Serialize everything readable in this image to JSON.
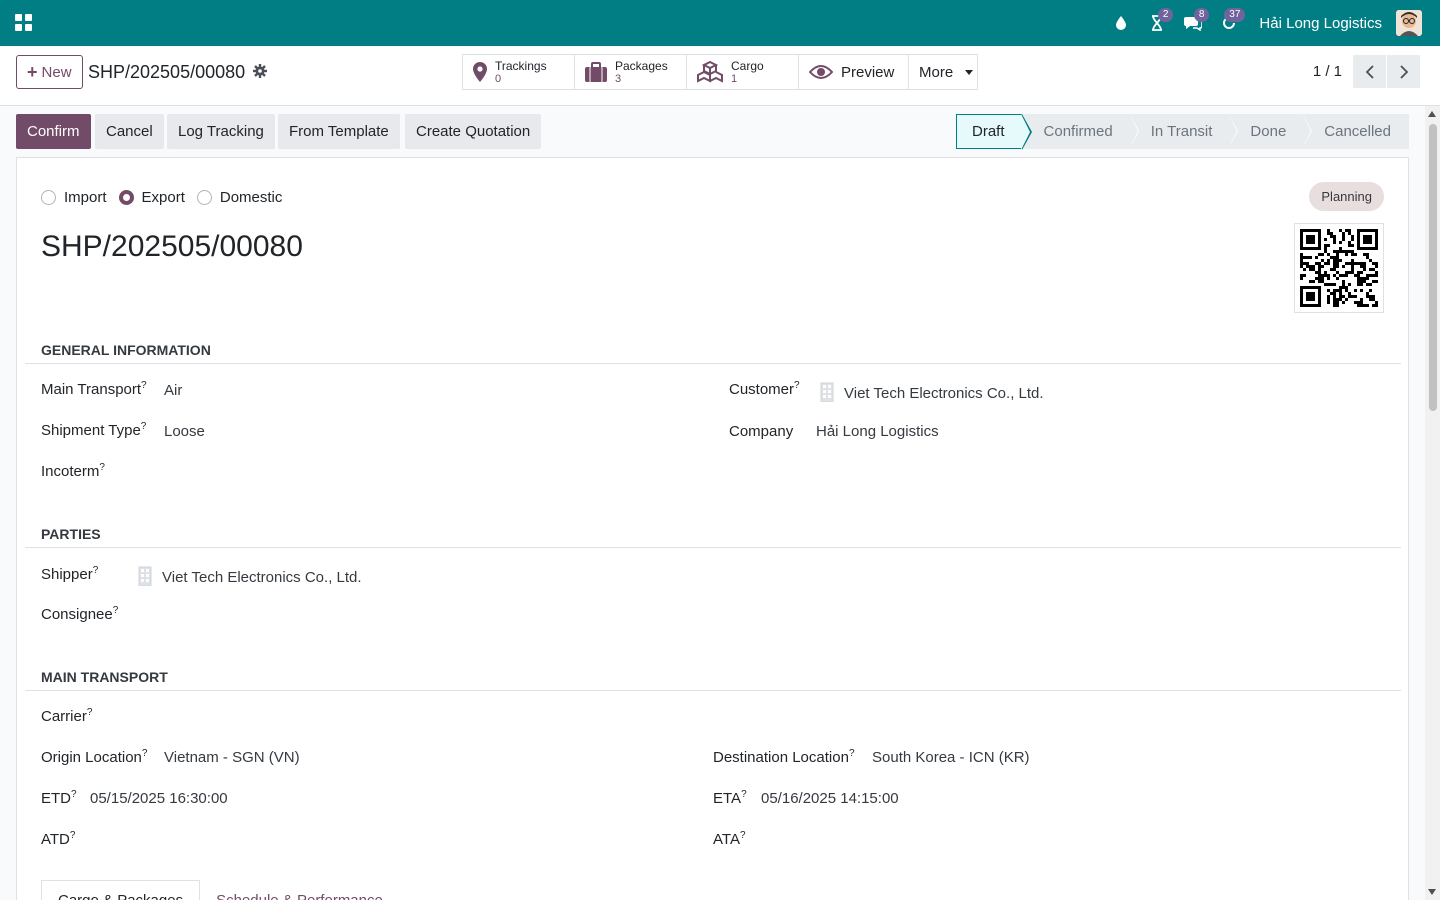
{
  "navbar": {
    "company": "Hải Long Logistics",
    "badges": {
      "activity": "2",
      "messages": "8",
      "updates": "37"
    },
    "accent_color": "#017e84"
  },
  "control": {
    "new_label": "New",
    "breadcrumb": "SHP/202505/00080",
    "smart_buttons": [
      {
        "label": "Trackings",
        "count": "0"
      },
      {
        "label": "Packages",
        "count": "3"
      },
      {
        "label": "Cargo",
        "count": "1"
      }
    ],
    "preview_label": "Preview",
    "more_label": "More",
    "pager": "1 / 1"
  },
  "header": {
    "buttons": [
      "Confirm",
      "Cancel",
      "Log Tracking",
      "From Template",
      "Create Quotation"
    ],
    "stages": [
      "Draft",
      "Confirmed",
      "In Transit",
      "Done",
      "Cancelled"
    ],
    "active_stage": "Draft"
  },
  "form": {
    "direction_options": [
      "Import",
      "Export",
      "Domestic"
    ],
    "direction_selected": "Export",
    "ribbon": "Planning",
    "title": "SHP/202505/00080",
    "general": {
      "heading": "GENERAL INFORMATION",
      "main_transport_label": "Main Transport",
      "main_transport": "Air",
      "shipment_type_label": "Shipment Type",
      "shipment_type": "Loose",
      "incoterm_label": "Incoterm",
      "customer_label": "Customer",
      "customer": "Viet Tech Electronics Co., Ltd.",
      "company_label": "Company",
      "company": "Hải Long Logistics"
    },
    "parties": {
      "heading": "PARTIES",
      "shipper_label": "Shipper",
      "shipper": "Viet Tech Electronics Co., Ltd.",
      "consignee_label": "Consignee"
    },
    "transport": {
      "heading": "MAIN TRANSPORT",
      "carrier_label": "Carrier",
      "origin_label": "Origin Location",
      "origin": "Vietnam - SGN (VN)",
      "destination_label": "Destination Location",
      "destination": "South Korea - ICN (KR)",
      "etd_label": "ETD",
      "etd": "05/15/2025 16:30:00",
      "eta_label": "ETA",
      "eta": "05/16/2025 14:15:00",
      "atd_label": "ATD",
      "ata_label": "ATA"
    },
    "tabs": [
      "Cargo & Packages",
      "Schedule & Performance"
    ]
  }
}
